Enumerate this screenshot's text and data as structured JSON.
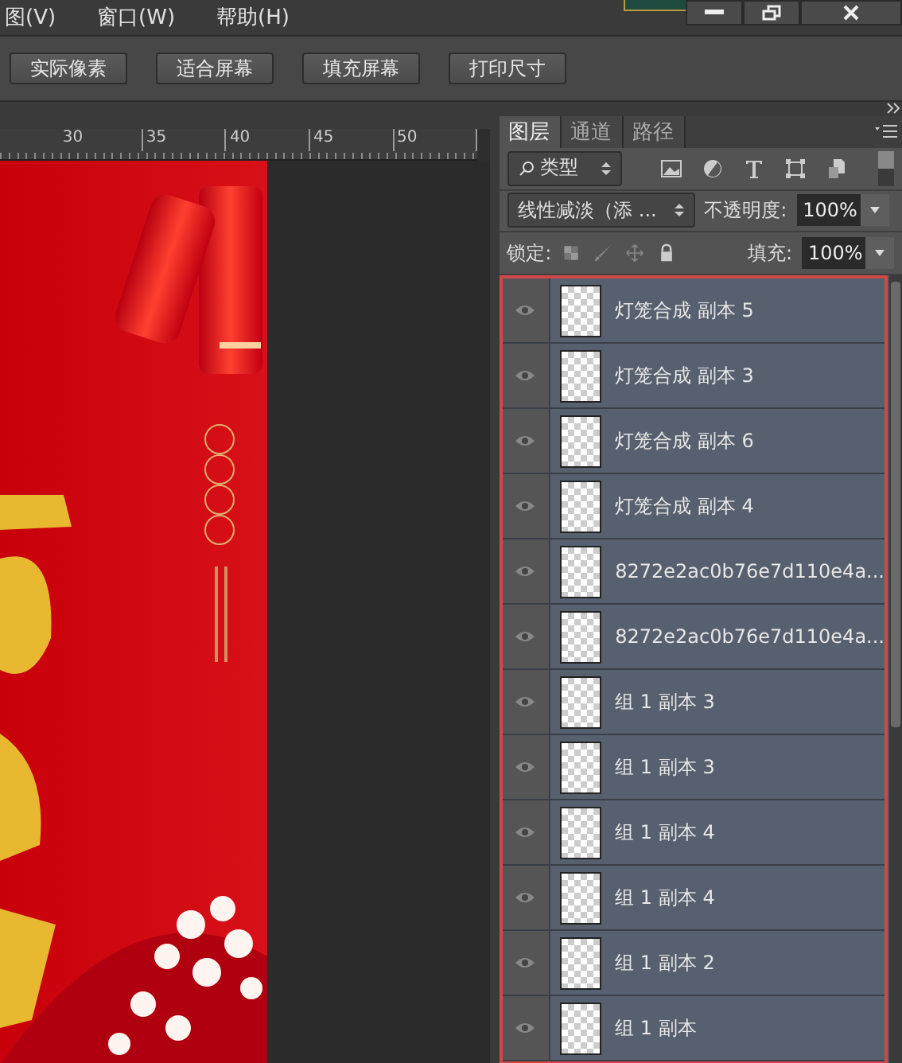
{
  "menu_bar": {
    "items": [
      "图(V)",
      "窗口(W)",
      "帮助(H)"
    ]
  },
  "toolbar": {
    "buttons": [
      "实际像素",
      "适合屏幕",
      "填充屏幕",
      "打印尺寸"
    ]
  },
  "ruler": {
    "labels": [
      "30",
      "35",
      "40",
      "45",
      "50"
    ]
  },
  "layers_panel": {
    "tabs": [
      {
        "label": "图层",
        "selected": true
      },
      {
        "label": "通道",
        "selected": false
      },
      {
        "label": "路径",
        "selected": false
      }
    ],
    "filter": {
      "value": "类型"
    },
    "blend_mode": {
      "value": "线性减淡（添 ..."
    },
    "opacity": {
      "label": "不透明度:",
      "value": "100%"
    },
    "lock": {
      "label": "锁定:"
    },
    "fill": {
      "label": "填充:",
      "value": "100%"
    },
    "layers": [
      {
        "name": "灯笼合成 副本 5",
        "visible": true,
        "selected": true
      },
      {
        "name": "灯笼合成 副本 3",
        "visible": true,
        "selected": true
      },
      {
        "name": "灯笼合成 副本 6",
        "visible": true,
        "selected": true
      },
      {
        "name": "灯笼合成 副本 4",
        "visible": true,
        "selected": true
      },
      {
        "name": "8272e2ac0b76e7d110e4a...",
        "visible": true,
        "selected": true
      },
      {
        "name": "8272e2ac0b76e7d110e4a...",
        "visible": true,
        "selected": true
      },
      {
        "name": "组 1 副本 3",
        "visible": true,
        "selected": true
      },
      {
        "name": "组 1 副本 3",
        "visible": true,
        "selected": true
      },
      {
        "name": "组 1 副本 4",
        "visible": true,
        "selected": true
      },
      {
        "name": "组 1 副本 4",
        "visible": true,
        "selected": true
      },
      {
        "name": "组 1 副本 2",
        "visible": true,
        "selected": true
      },
      {
        "name": "组 1 副本",
        "visible": true,
        "selected": true
      }
    ]
  }
}
